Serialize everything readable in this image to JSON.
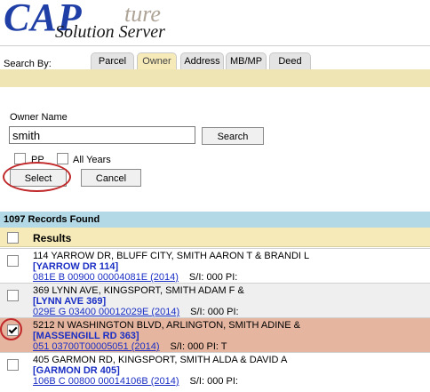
{
  "logo": {
    "cap": "CAP",
    "ture": "ture",
    "subtitle": "Solution Server"
  },
  "search_by_label": "Search By:",
  "tabs": [
    {
      "label": "Parcel",
      "active": false
    },
    {
      "label": "Owner",
      "active": true
    },
    {
      "label": "Address",
      "active": false
    },
    {
      "label": "MB/MP",
      "active": false
    },
    {
      "label": "Deed",
      "active": false
    }
  ],
  "form": {
    "owner_label": "Owner Name",
    "owner_value": "smith",
    "search_button": "Search",
    "pp_label": "PP",
    "all_years_label": "All Years",
    "select_button": "Select",
    "cancel_button": "Cancel"
  },
  "records_found": "1097 Records Found",
  "results_header": "Results",
  "results": [
    {
      "line1": "114 YARROW DR, BLUFF CITY, SMITH AARON T & BRANDI L",
      "line2": "[YARROW DR 114]",
      "pin": "081E B 00900 00004081E (2014)",
      "meta": "S/I: 000   PI:",
      "checked": false
    },
    {
      "line1": "369 LYNN AVE, KINGSPORT, SMITH ADAM F &",
      "line2": "[LYNN AVE 369]",
      "pin": "029E G 03400 00012029E (2014)",
      "meta": "S/I: 000   PI:",
      "checked": false
    },
    {
      "line1": "5212 N WASHINGTON BLVD, ARLINGTON, SMITH ADINE &",
      "line2": "[MASSENGILL RD 363]",
      "pin": "051 03700T00005051 (2014)",
      "meta": "S/I: 000   PI: T",
      "checked": true
    },
    {
      "line1": "405 GARMON RD, KINGSPORT, SMITH ALDA & DAVID A",
      "line2": "[GARMON DR 405]",
      "pin": "106B C 00800 00014106B (2014)",
      "meta": "S/I: 000   PI:",
      "checked": false
    }
  ],
  "colors": {
    "accent_blue": "#1a2ec4",
    "tab_active": "#f6eab8",
    "records_bar": "#b2d9e5",
    "selected_row": "#e5b5a0",
    "highlight_circle": "#c0282a"
  }
}
